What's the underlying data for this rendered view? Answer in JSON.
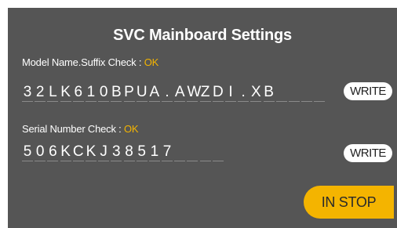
{
  "title": "SVC Mainboard Settings",
  "model": {
    "label": "Model Name.Suffix Check : ",
    "status": "OK",
    "value_chars": [
      "3",
      "2",
      "L",
      "K",
      "6",
      "1",
      "0",
      "B",
      "P",
      "U",
      "A",
      ".",
      "A",
      "W",
      "Z",
      "D",
      "I",
      ".",
      "X",
      "B",
      "",
      "",
      "",
      ""
    ],
    "write_label": "WRITE"
  },
  "serial": {
    "label": "Serial Number Check : ",
    "status": "OK",
    "value_chars": [
      "5",
      "0",
      "6",
      "K",
      "C",
      "K",
      "J",
      "3",
      "8",
      "5",
      "1",
      "7",
      "",
      "",
      "",
      ""
    ],
    "write_label": "WRITE"
  },
  "stop_label": "IN STOP",
  "colors": {
    "panel_bg": "#555555",
    "accent": "#f4b400",
    "ok": "#f4b400"
  }
}
